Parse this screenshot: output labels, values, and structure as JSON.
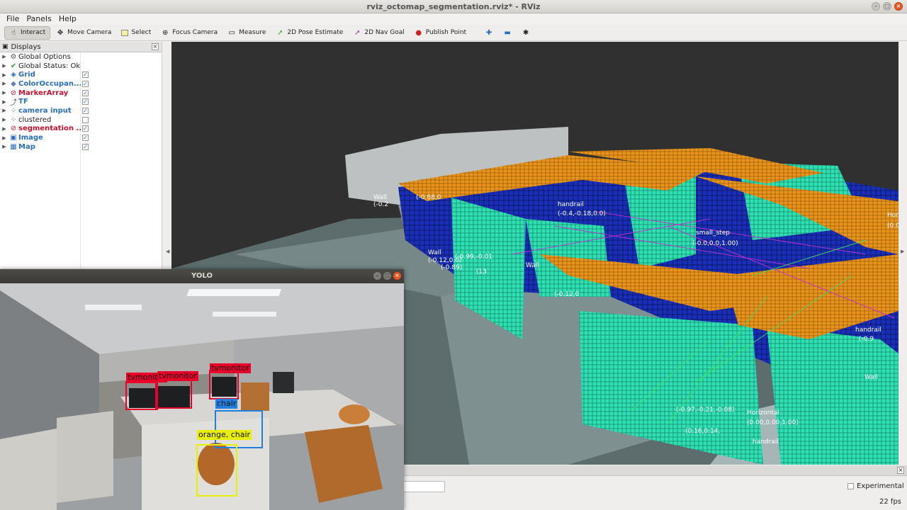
{
  "window": {
    "title": "rviz_octomap_segmentation.rviz* - RViz"
  },
  "menu": {
    "file": "File",
    "panels": "Panels",
    "help": "Help"
  },
  "toolbar": {
    "interact": "Interact",
    "move_camera": "Move Camera",
    "select": "Select",
    "focus_camera": "Focus Camera",
    "measure": "Measure",
    "pose_estimate": "2D Pose Estimate",
    "nav_goal": "2D Nav Goal",
    "publish_point": "Publish Point"
  },
  "displays": {
    "title": "Displays",
    "items": [
      {
        "label": "Global Options",
        "icon": "gear-icon",
        "style": "plain",
        "checked": null
      },
      {
        "label": "Global Status: Ok",
        "icon": "check-icon",
        "style": "plain",
        "checked": null
      },
      {
        "label": "Grid",
        "icon": "grid-icon",
        "style": "blue",
        "checked": true
      },
      {
        "label": "ColorOccupan...",
        "icon": "cube-icon",
        "style": "blue",
        "checked": true
      },
      {
        "label": "MarkerArray",
        "icon": "error-icon",
        "style": "red",
        "checked": true
      },
      {
        "label": "TF",
        "icon": "tf-icon",
        "style": "blue",
        "checked": true
      },
      {
        "label": "camera input",
        "icon": "pointcloud-icon",
        "style": "blue",
        "checked": true
      },
      {
        "label": "clustered",
        "icon": "pointcloud-icon",
        "style": "plain",
        "checked": false
      },
      {
        "label": "segmentation ...",
        "icon": "error-icon",
        "style": "red",
        "checked": true
      },
      {
        "label": "Image",
        "icon": "image-icon",
        "style": "blue",
        "checked": true
      },
      {
        "label": "Map",
        "icon": "map-icon",
        "style": "blue",
        "checked": true
      }
    ]
  },
  "viewport": {
    "labels": [
      "Wall",
      "(-0.2",
      "(-0.68,0",
      "handrail",
      "(-0.4,-0.18,0.0)",
      "small_step",
      "(-0.0,0.0,1.00)",
      "Wall",
      "(-0.12,0.0)",
      "(-0.89)",
      "(-0.99,-0.01",
      "(13",
      "Wall",
      "(-0.12,0",
      "(-0.97,-0.21,-0.08)",
      "(0.16,0.14,",
      "Horizontal",
      "(0.00,0.00,1.00)",
      "handrail",
      "handrail",
      "(-0.9",
      "Wall",
      "Hor",
      "(0.0"
    ]
  },
  "yolo": {
    "title": "YOLO",
    "detections": [
      {
        "label": "tvmonitor",
        "color": "#e8002a"
      },
      {
        "label": "tvmonitor",
        "color": "#e8002a"
      },
      {
        "label": "tvmonitor",
        "color": "#e8002a"
      },
      {
        "label": "chair",
        "color": "#1e7fe0"
      },
      {
        "label": "orange, chair",
        "color": "#e8f000"
      }
    ]
  },
  "bottom": {
    "experimental": "Experimental",
    "fps": "22 fps"
  },
  "colors": {
    "voxel_teal": "#2fe0b0",
    "voxel_orange": "#e8951e",
    "voxel_blue": "#1a2fb8",
    "floor": "#5a6a6a"
  }
}
